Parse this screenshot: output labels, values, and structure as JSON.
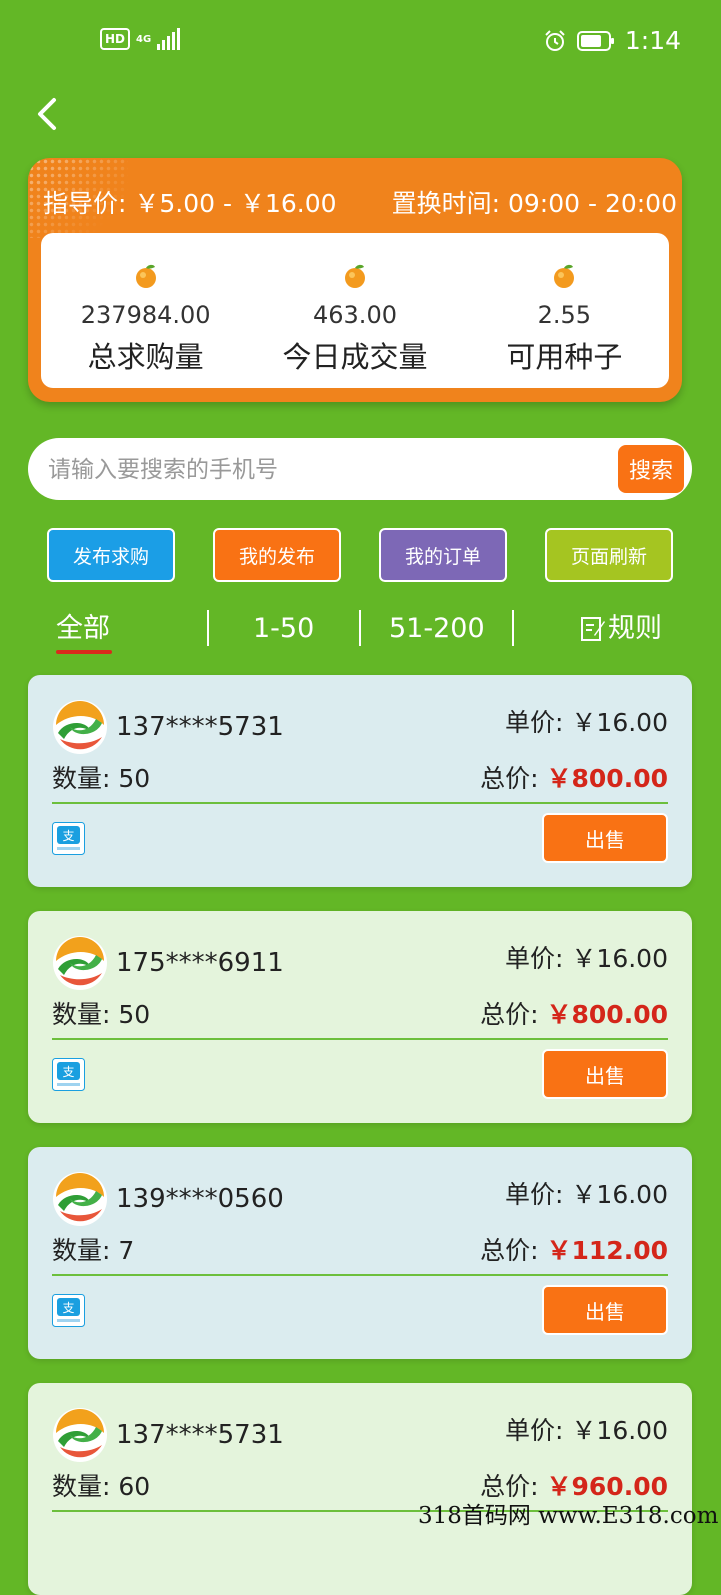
{
  "status_bar": {
    "hd": "HD",
    "network": "4G",
    "time": "1:14"
  },
  "summary": {
    "guide_price": "指导价: ￥5.00 - ￥16.00",
    "swap_time": "置换时间: 09:00 - 20:00",
    "stats": [
      {
        "value": "237984.00",
        "label": "总求购量"
      },
      {
        "value": "463.00",
        "label": "今日成交量"
      },
      {
        "value": "2.55",
        "label": "可用种子"
      }
    ]
  },
  "search": {
    "placeholder": "请输入要搜索的手机号",
    "button": "搜索"
  },
  "actions": {
    "publish": "发布求购",
    "mine": "我的发布",
    "orders": "我的订单",
    "refresh": "页面刷新"
  },
  "tabs": {
    "all": "全部",
    "range1": "1-50",
    "range2": "51-200",
    "rules": "规则"
  },
  "labels": {
    "unit_price": "单价: ",
    "quantity": "数量: ",
    "total": "总价: ",
    "sell": "出售"
  },
  "orders": [
    {
      "phone": "137****5731",
      "unit_price": "￥16.00",
      "quantity": "50",
      "total": "￥800.00"
    },
    {
      "phone": "175****6911",
      "unit_price": "￥16.00",
      "quantity": "50",
      "total": "￥800.00"
    },
    {
      "phone": "139****0560",
      "unit_price": "￥16.00",
      "quantity": "7",
      "total": "￥112.00"
    },
    {
      "phone": "137****5731",
      "unit_price": "￥16.00",
      "quantity": "60",
      "total": "￥960.00"
    }
  ],
  "watermark": "318首码网 www.E318.com",
  "colors": {
    "background": "#63b726",
    "summary_card": "#f0831c",
    "action_orange": "#f97214",
    "price_red": "#d4261a"
  }
}
